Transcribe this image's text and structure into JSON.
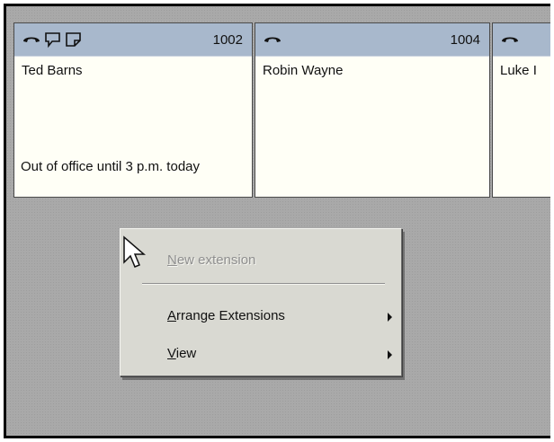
{
  "cards": [
    {
      "extension": "1002",
      "name": "Ted Barns",
      "status": "Out of office until 3 p.m. today",
      "icons": [
        "phone-handset-icon",
        "speech-bubble-icon",
        "note-icon"
      ]
    },
    {
      "extension": "1004",
      "name": "Robin Wayne",
      "status": "",
      "icons": [
        "phone-handset-icon"
      ]
    },
    {
      "extension": "",
      "name": "Luke I",
      "status": "",
      "icons": [
        "phone-handset-icon"
      ]
    }
  ],
  "context_menu": {
    "items": [
      {
        "mnemonic": "N",
        "rest": "ew extension",
        "enabled": false,
        "submenu": false
      },
      {
        "mnemonic": "A",
        "rest": "rrange Extensions",
        "enabled": true,
        "submenu": true
      },
      {
        "mnemonic": "V",
        "rest": "iew",
        "enabled": true,
        "submenu": true
      }
    ]
  },
  "colors": {
    "card_header": "#a8b8cc",
    "card_body": "#fffff6",
    "workspace": "#a9a9a9",
    "menu_background": "#d9d9d2",
    "disabled_text": "#8f8f8f"
  }
}
